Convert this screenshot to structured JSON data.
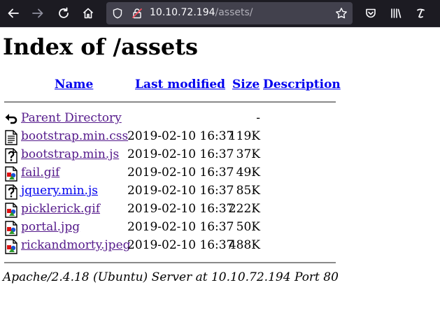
{
  "browser": {
    "url_host": "10.10.72.194",
    "url_path": "/assets/"
  },
  "page": {
    "title": "Index of /assets",
    "columns": {
      "name": "Name",
      "last_modified": "Last modified",
      "size": "Size",
      "description": "Description"
    },
    "parent": {
      "label": "Parent Directory",
      "size": "-",
      "icon": "back-icon"
    },
    "files": [
      {
        "name": "bootstrap.min.css",
        "modified": "2019-02-10 16:37",
        "size": "119K",
        "icon": "text-file-icon",
        "visited": true
      },
      {
        "name": "bootstrap.min.js",
        "modified": "2019-02-10 16:37",
        "size": "37K",
        "icon": "unknown-file-icon",
        "visited": true
      },
      {
        "name": "fail.gif",
        "modified": "2019-02-10 16:37",
        "size": "49K",
        "icon": "image-file-icon",
        "visited": true
      },
      {
        "name": "jquery.min.js",
        "modified": "2019-02-10 16:37",
        "size": "85K",
        "icon": "unknown-file-icon",
        "visited": false
      },
      {
        "name": "picklerick.gif",
        "modified": "2019-02-10 16:37",
        "size": "222K",
        "icon": "image-file-icon",
        "visited": true
      },
      {
        "name": "portal.jpg",
        "modified": "2019-02-10 16:37",
        "size": "50K",
        "icon": "image-file-icon",
        "visited": true
      },
      {
        "name": "rickandmorty.jpeg",
        "modified": "2019-02-10 16:37",
        "size": "488K",
        "icon": "image-file-icon",
        "visited": true
      }
    ],
    "footer": "Apache/2.4.18 (Ubuntu) Server at 10.10.72.194 Port 80"
  }
}
